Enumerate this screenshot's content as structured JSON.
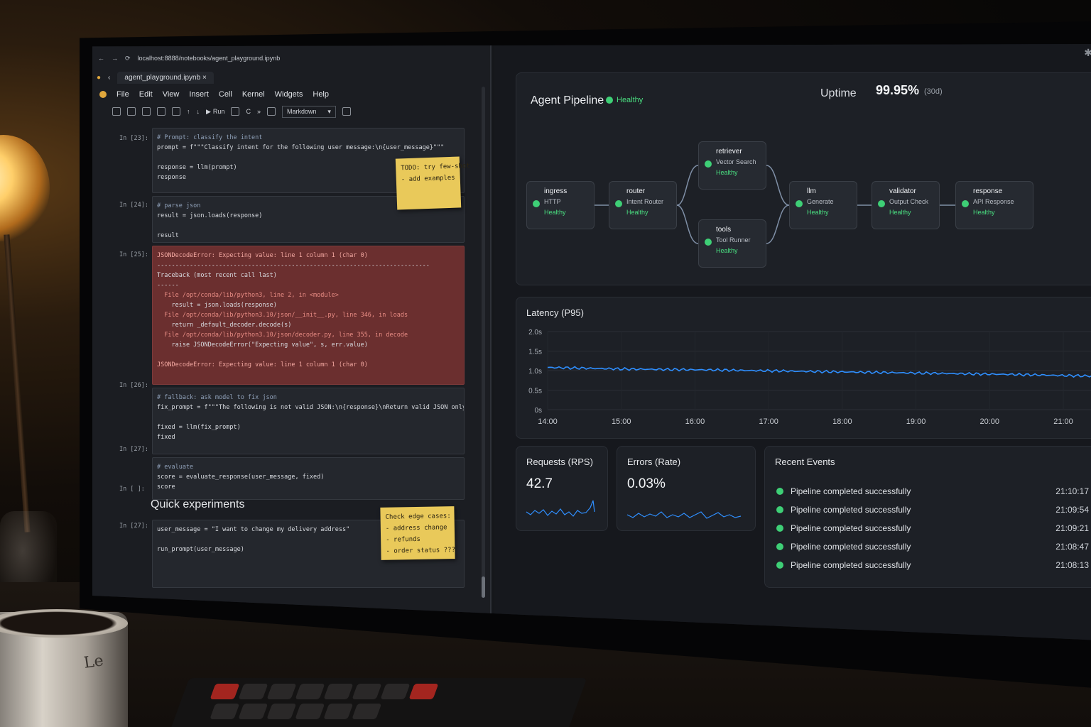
{
  "browser": {
    "url": "localhost:8888/notebooks/agent_playground.ipynb"
  },
  "notebook": {
    "tab_title": "agent_playground.ipynb",
    "menu": [
      "File",
      "Edit",
      "View",
      "Insert",
      "Cell",
      "Kernel",
      "Widgets",
      "Help"
    ],
    "toolbar": {
      "run_label": "Run",
      "cell_type": "Markdown"
    },
    "cells": [
      {
        "prompt": "In [23]:",
        "lines": [
          "# Prompt: classify the intent",
          "prompt = f\"\"\"Classify intent for the following user message:\\n{user_message}\"\"\"",
          "",
          "response = llm(prompt)",
          "response"
        ]
      },
      {
        "prompt": "In [24]:",
        "lines": [
          "# parse json",
          "result = json.loads(response)",
          "",
          "result"
        ]
      },
      {
        "prompt": "In [25]:",
        "lines": [
          "JSONDecodeError: Expecting value: line 1 column 1 (char 0)",
          "---------------------------------------------------------------------------",
          "Traceback (most recent call last)",
          "------",
          "  File /opt/conda/lib/python3, line 2, in <module>",
          "    result = json.loads(response)",
          "  File /opt/conda/lib/python3.10/json/__init__.py, line 346, in loads",
          "    return _default_decoder.decode(s)",
          "  File /opt/conda/lib/python3.10/json/decoder.py, line 355, in decode",
          "    raise JSONDecodeError(\"Expecting value\", s, err.value)",
          "",
          "JSONDecodeError: Expecting value: line 1 column 1 (char 0)"
        ]
      },
      {
        "prompt": "In [26]:",
        "lines": [
          "# fallback: ask model to fix json",
          "fix_prompt = f\"\"\"The following is not valid JSON:\\n{response}\\nReturn valid JSON only:\"\"\"",
          "",
          "fixed = llm(fix_prompt)",
          "fixed"
        ]
      },
      {
        "prompt": "In [27]:",
        "lines": [
          "# evaluate",
          "score = evaluate_response(user_message, fixed)",
          "score"
        ]
      },
      {
        "prompt": "In [ ]:",
        "lines": []
      },
      {
        "prompt": "In [27]:",
        "lines": [
          "user_message = \"I want to change my delivery address\"",
          "",
          "run_prompt(user_message)"
        ]
      }
    ],
    "markdown_heading": "Quick experiments",
    "sticky_notes": [
      {
        "text": "TODO: try few-shot\n- add examples"
      },
      {
        "text": "Check edge cases:\n- address change\n- refunds\n- order status ???"
      }
    ]
  },
  "dashboard": {
    "pipeline": {
      "title": "Agent Pipeline",
      "status": "Healthy",
      "uptime_label": "Uptime",
      "uptime_value": "99.95%",
      "uptime_window": "(30d)",
      "nodes": [
        {
          "name": "ingress",
          "sub": "HTTP",
          "status": "Healthy"
        },
        {
          "name": "router",
          "sub": "Intent Router",
          "status": "Healthy"
        },
        {
          "name": "retriever",
          "sub": "Vector Search",
          "status": "Healthy"
        },
        {
          "name": "tools",
          "sub": "Tool Runner",
          "status": "Healthy"
        },
        {
          "name": "llm",
          "sub": "Generate",
          "status": "Healthy"
        },
        {
          "name": "validator",
          "sub": "Output Check",
          "status": "Healthy"
        },
        {
          "name": "response",
          "sub": "API Response",
          "status": "Healthy"
        }
      ]
    },
    "latency": {
      "title": "Latency (P95)",
      "y_ticks": [
        "2.0s",
        "1.5s",
        "1.0s",
        "0.5s",
        "0s"
      ],
      "x_ticks": [
        "14:00",
        "15:00",
        "16:00",
        "17:00",
        "18:00",
        "19:00",
        "20:00",
        "21:00"
      ]
    },
    "requests": {
      "title": "Requests (RPS)",
      "value": "42.7"
    },
    "errors": {
      "title": "Errors (Rate)",
      "value": "0.03%"
    },
    "events": {
      "title": "Recent Events",
      "items": [
        {
          "text": "Pipeline completed successfully",
          "time": "21:10:17"
        },
        {
          "text": "Pipeline completed successfully",
          "time": "21:09:54"
        },
        {
          "text": "Pipeline completed successfully",
          "time": "21:09:21"
        },
        {
          "text": "Pipeline completed successfully",
          "time": "21:08:47"
        },
        {
          "text": "Pipeline completed successfully",
          "time": "21:08:13"
        }
      ]
    },
    "colors": {
      "healthy": "#3ecf76",
      "series": "#2f8fff",
      "error_cell": "#6b2f2f"
    }
  },
  "chart_data": [
    {
      "type": "line",
      "title": "Latency (P95)",
      "xlabel": "",
      "ylabel": "",
      "x": [
        "14:00",
        "15:00",
        "16:00",
        "17:00",
        "18:00",
        "19:00",
        "20:00",
        "21:00"
      ],
      "series": [
        {
          "values": [
            1.08,
            1.04,
            1.02,
            0.99,
            0.96,
            0.93,
            0.9,
            0.86
          ]
        }
      ],
      "ylim": [
        0,
        2.0
      ],
      "grid": true
    }
  ],
  "desk": {
    "mug_text": "Le"
  }
}
